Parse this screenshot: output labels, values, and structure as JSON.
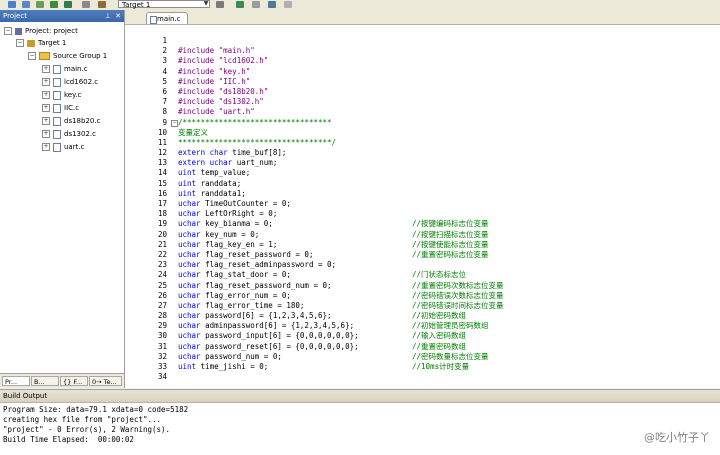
{
  "toolbar": {
    "target_select": "Target 1",
    "icons": [
      "save-icon",
      "save-all-icon",
      "translate-icon",
      "build-icon",
      "rebuild-icon",
      "load-icon",
      "target-options-icon",
      "manage-icon",
      "pack-icon",
      "diamond-icon"
    ]
  },
  "project_panel": {
    "title": "Project",
    "pin_icon": "pin-icon",
    "close_icon": "close-icon",
    "tree": {
      "root": "Project: project",
      "target": "Target 1",
      "group": "Source Group 1",
      "files": [
        "main.c",
        "lcd1602.c",
        "key.c",
        "IIC.c",
        "ds18b20.c",
        "ds1302.c",
        "uart.c"
      ]
    },
    "tabs": [
      "Pr...",
      "B...",
      "{} F...",
      "0→ Te..."
    ]
  },
  "editor": {
    "tab": "main.c",
    "lines": [
      {
        "n": "1",
        "text": "",
        "comment": ""
      },
      {
        "n": "2",
        "text": "#include \"main.h\"",
        "comment": ""
      },
      {
        "n": "3",
        "text": "#include \"lcd1602.h\"",
        "comment": ""
      },
      {
        "n": "4",
        "text": "#include \"key.h\"",
        "comment": ""
      },
      {
        "n": "5",
        "text": "#include \"IIC.h\"",
        "comment": ""
      },
      {
        "n": "6",
        "text": "#include \"ds18b20.h\"",
        "comment": ""
      },
      {
        "n": "7",
        "text": "#include \"ds1302.h\"",
        "comment": ""
      },
      {
        "n": "8",
        "text": "#include \"uart.h\"",
        "comment": ""
      },
      {
        "n": "9",
        "text": "/*********************************",
        "comment": ""
      },
      {
        "n": "10",
        "text": "变量定义",
        "comment": ""
      },
      {
        "n": "11",
        "text": "**********************************/",
        "comment": ""
      },
      {
        "n": "12",
        "text": "extern char time_buf[8];",
        "comment": ""
      },
      {
        "n": "13",
        "text": "extern uchar uart_num;",
        "comment": ""
      },
      {
        "n": "14",
        "text": "uint temp_value;",
        "comment": ""
      },
      {
        "n": "15",
        "text": "uint randdata;",
        "comment": ""
      },
      {
        "n": "16",
        "text": "uint randdata1;",
        "comment": ""
      },
      {
        "n": "17",
        "text": "uchar TimeOutCounter = 0;",
        "comment": ""
      },
      {
        "n": "18",
        "text": "uchar LeftOrRight = 0;",
        "comment": ""
      },
      {
        "n": "19",
        "text": "uchar key_bianma = 0;",
        "comment": "//按键编码标志位变量"
      },
      {
        "n": "20",
        "text": "uchar key_num = 0;",
        "comment": "//按键扫描标志位变量"
      },
      {
        "n": "21",
        "text": "uchar flag_key_en = 1;",
        "comment": "//按键使能标志位变量"
      },
      {
        "n": "22",
        "text": "uchar flag_reset_password = 0;",
        "comment": "//重置密码标志位变量"
      },
      {
        "n": "23",
        "text": "uchar flag_reset_adminpassword = 0;",
        "comment": ""
      },
      {
        "n": "24",
        "text": "uchar flag_stat_door = 0;",
        "comment": "//门状态标志位"
      },
      {
        "n": "25",
        "text": "uchar flag_reset_password_num = 0;",
        "comment": "//重置密码次数标志位变量"
      },
      {
        "n": "26",
        "text": "uchar flag_error_num = 0;",
        "comment": "//密码错误次数标志位变量"
      },
      {
        "n": "27",
        "text": "uchar flag_error_time = 180;",
        "comment": "//密码错误时间标志位变量"
      },
      {
        "n": "28",
        "text": "uchar password[6] = {1,2,3,4,5,6};",
        "comment": "//初始密码数组"
      },
      {
        "n": "29",
        "text": "uchar adminpassword[6] = {1,2,3,4,5,6};",
        "comment": "//初始管理员密码数组"
      },
      {
        "n": "30",
        "text": "uchar password_input[6] = {0,0,0,0,0,0};",
        "comment": "//输入密码数组"
      },
      {
        "n": "31",
        "text": "uchar password_reset[6] = {0,0,0,0,0,0};",
        "comment": "//重置密码数组"
      },
      {
        "n": "32",
        "text": "uchar password_num = 0;",
        "comment": "//密码数量标志位变量"
      },
      {
        "n": "33",
        "text": "uint time_jishi = 0;",
        "comment": "//10ms计时变量"
      },
      {
        "n": "34",
        "text": "",
        "comment": ""
      }
    ]
  },
  "build_output": {
    "title": "Build Output",
    "lines": [
      "Program Size: data=79.1 xdata=0 code=5182",
      "creating hex file from \"project\"...",
      "\"project\" - 0 Error(s), 2 Warning(s).",
      "Build Time Elapsed:  00:00:02"
    ]
  },
  "watermark": "@吃小竹子丫",
  "colors": {
    "keyword": "#0000ff",
    "string": "#7b007b",
    "comment": "#008000",
    "preprocessor": "#6e6e6e",
    "panel_title": "#3a66aa"
  }
}
